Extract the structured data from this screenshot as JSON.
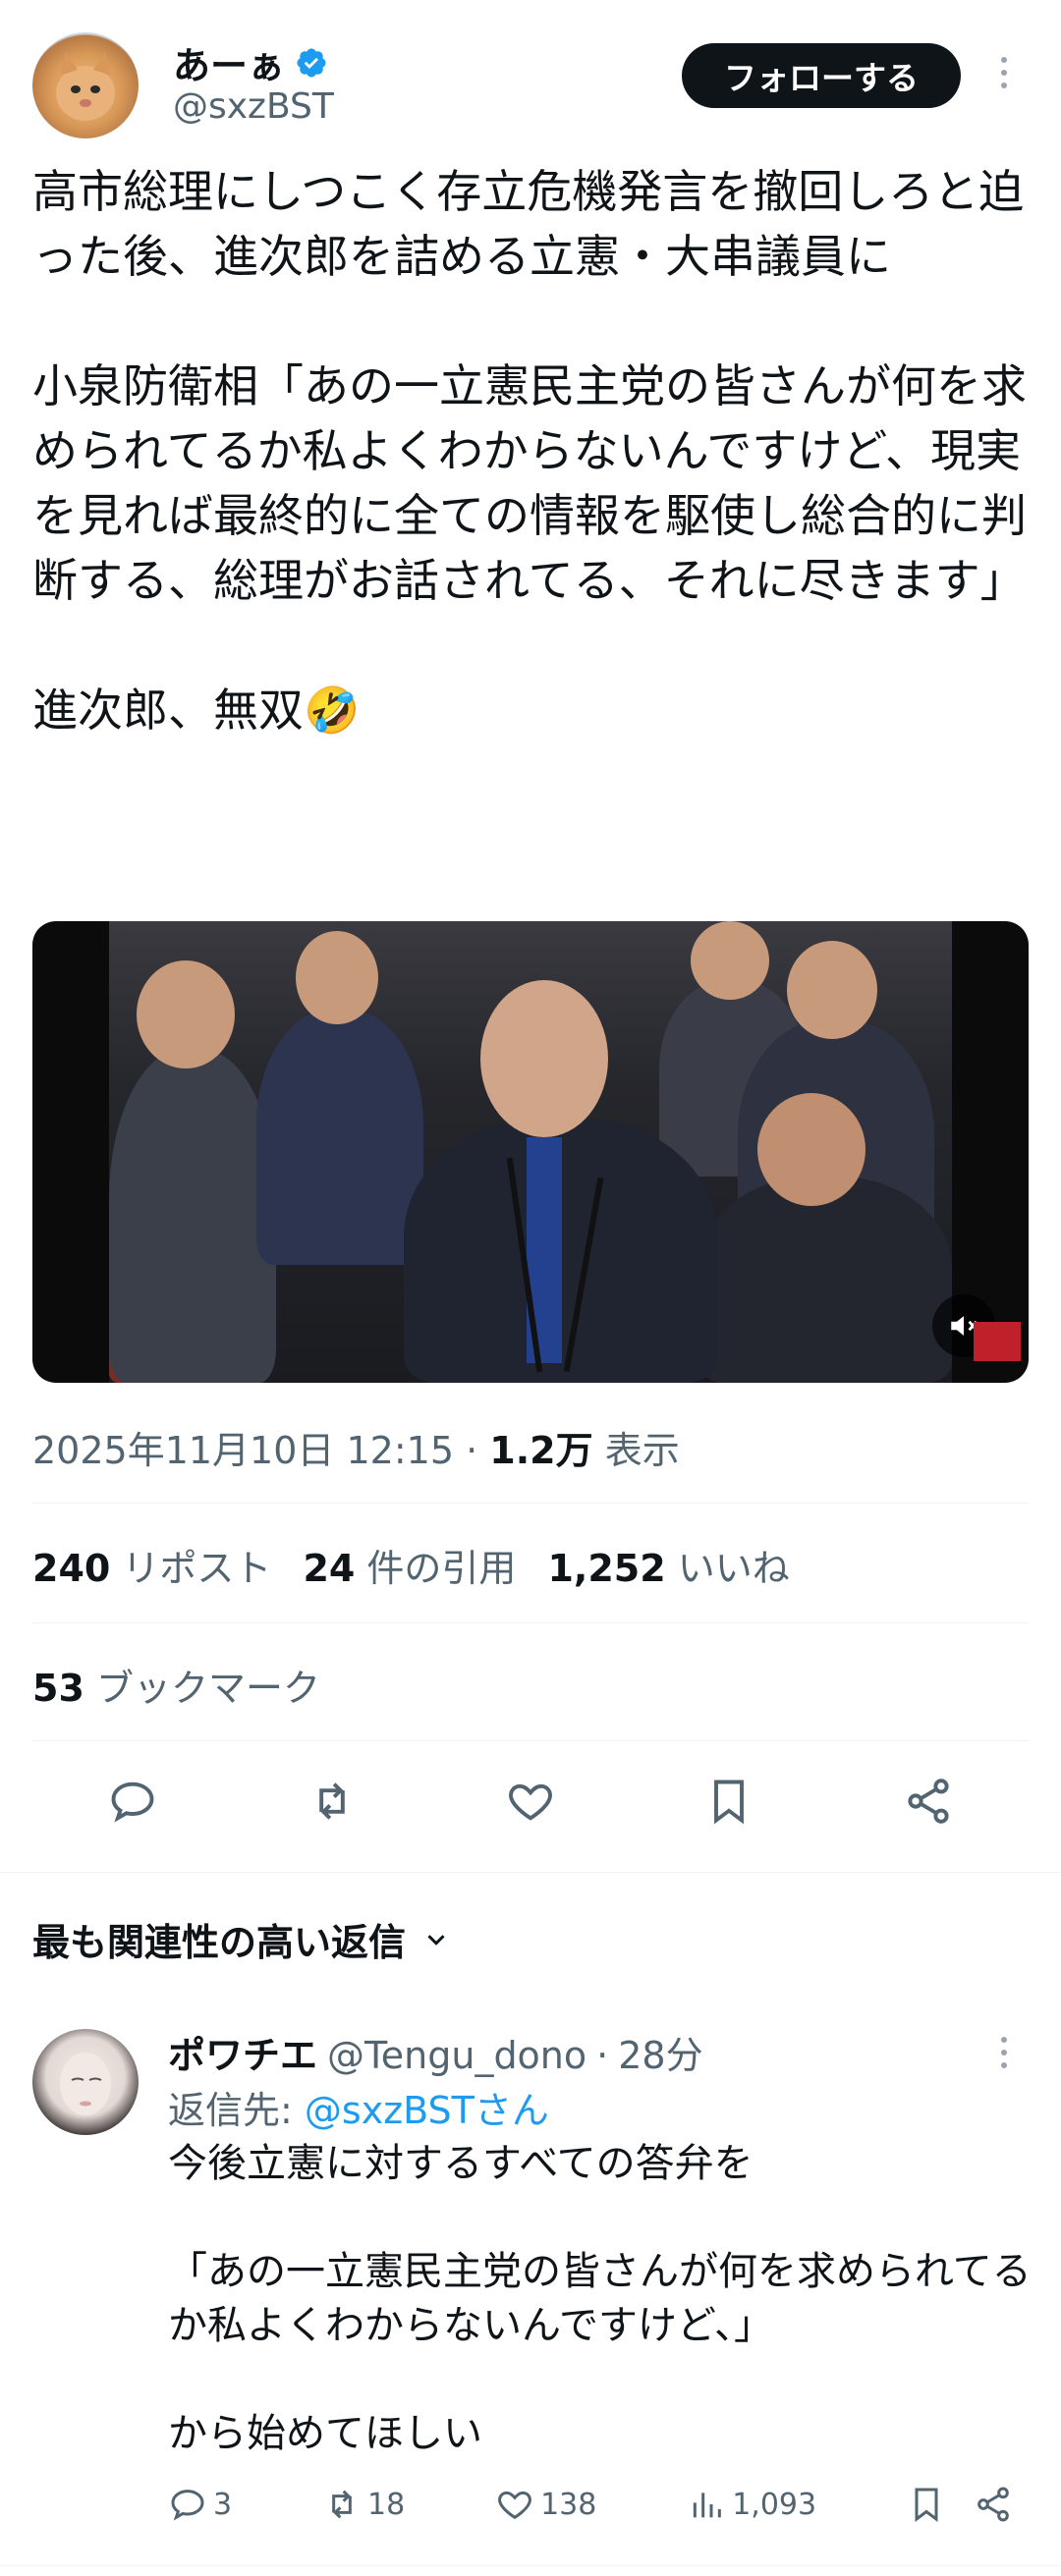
{
  "author": {
    "display_name": "あーぁ",
    "handle": "@sxzBST",
    "follow_label": "フォローする"
  },
  "tweet": {
    "text": "高市総理にしつこく存立危機発言を撤回しろと迫った後、進次郎を詰める立憲・大串議員に\n\n小泉防衛相「あの一立憲民主党の皆さんが何を求められてるか私よくわからないんですけど、現実を見れば最終的に全ての情報を駆使し総合的に判断する、総理がお話されてる、それに尽きます」\n\n進次郎、無双🤣",
    "timestamp": "2025年11月10日 12:15",
    "sep": "·",
    "views": "1.2万",
    "views_label": "表示"
  },
  "stats": {
    "reposts": "240",
    "reposts_label": "リポスト",
    "quotes": "24",
    "quotes_label": "件の引用",
    "likes": "1,252",
    "likes_label": "いいね",
    "bookmarks": "53",
    "bookmarks_label": "ブックマーク"
  },
  "sort": {
    "label": "最も関連性の高い返信"
  },
  "reply": {
    "name": "ポワチエ",
    "handle": "@Tengu_dono",
    "sep": "·",
    "time": "28分",
    "reply_to_prefix": "返信先:",
    "reply_to_handle": "@sxzBSTさん",
    "text": "今後立憲に対するすべての答弁を\n\n「あの一立憲民主党の皆さんが何を求められてるか私よくわからないんですけど、」\n\nから始めてほしい",
    "comments": "3",
    "retweets": "18",
    "likes": "138",
    "views": "1,093"
  },
  "colors": {
    "verified": "#1d9bf0",
    "link": "#1d9bf0",
    "muted": "#536471"
  },
  "icons": [
    "verified-badge-icon",
    "more-icon",
    "mute-icon",
    "reply-icon",
    "retweet-icon",
    "like-icon",
    "bookmark-icon",
    "share-icon",
    "chevron-down-icon",
    "views-icon"
  ]
}
